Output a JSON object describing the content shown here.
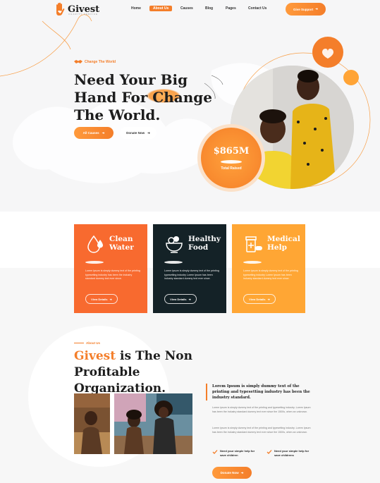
{
  "brand": {
    "name": "Givest",
    "sub": "CHARITY SERVICE"
  },
  "nav": {
    "items": [
      {
        "label": "Home",
        "active": false
      },
      {
        "label": "About Us",
        "active": true
      },
      {
        "label": "Causes",
        "active": false
      },
      {
        "label": "Blog",
        "active": false
      },
      {
        "label": "Pages",
        "active": false
      },
      {
        "label": "Contact Us",
        "active": false
      }
    ],
    "cta": "Give Support"
  },
  "hero": {
    "tagline": "Change The World",
    "title_line1": "Need Your Big",
    "title_line2a": "Hand For",
    "title_line2b": "Change",
    "title_line3": "The World.",
    "primary_button": "All Causes",
    "secondary_button": "Donate Now",
    "raised_amount": "$865M",
    "raised_label": "Total Raised"
  },
  "cards": [
    {
      "title_line1": "Clean",
      "title_line2": "Water",
      "text": "Lorem ipsum is simply dummy text of the printing typesetting industry has been the industry standard dummy text ever since.",
      "button": "View Details",
      "icon": "water-drops-icon"
    },
    {
      "title_line1": "Healthy",
      "title_line2": "Food",
      "text": "Lorem ipsum is simply dummy text of the printing typesetting industry Lorem Ipsum has been industry standard dummy text ever since.",
      "button": "View Details",
      "icon": "food-bowl-icon"
    },
    {
      "title_line1": "Medical",
      "title_line2": "Help",
      "text": "Lorem ipsum is simply dummy text of the printing typesetting industry Lorem Ipsum has been industry standard dummy text ever since.",
      "button": "View Details",
      "icon": "medicine-icon"
    }
  ],
  "about": {
    "tag": "About Us",
    "title_brand": "Givest",
    "title_rest1": " is The Non Profitable",
    "title_rest2": "Organization.",
    "lead": "Lorem Ipsum is simply dummy text of the printing and typesetting industry has been the industry standard.",
    "para1": "Lorem ipsum is simply dummy text of the printing and typesetting industry. Lorem Ipsum has been the industry standard dummy text ever since the 1500s, when an unknown.",
    "para2": "Lorem ipsum is simply dummy text of the printing and typesetting industry. Lorem Ipsum has been the industry standard dummy text ever since the 1500s, when an unknown.",
    "check1": "Need your simple help for save children",
    "check2": "Need your simple help for save childrens",
    "button": "Donate Now"
  },
  "colors": {
    "accent": "#f47e2a",
    "accent_light": "#ffa436",
    "dark": "#142227",
    "card_orange": "#f86a2f",
    "card_amber": "#ffa634"
  }
}
